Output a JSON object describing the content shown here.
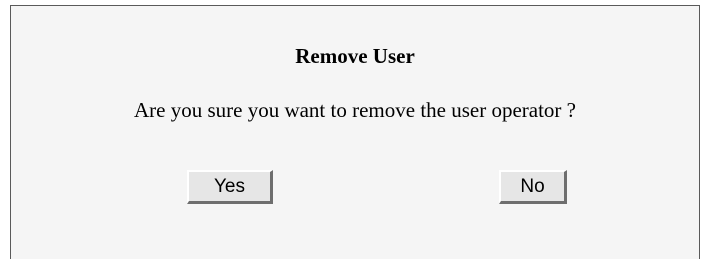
{
  "dialog": {
    "title": "Remove User",
    "message": "Are you sure you want to remove the user operator ?",
    "yes_label": "Yes",
    "no_label": "No"
  }
}
